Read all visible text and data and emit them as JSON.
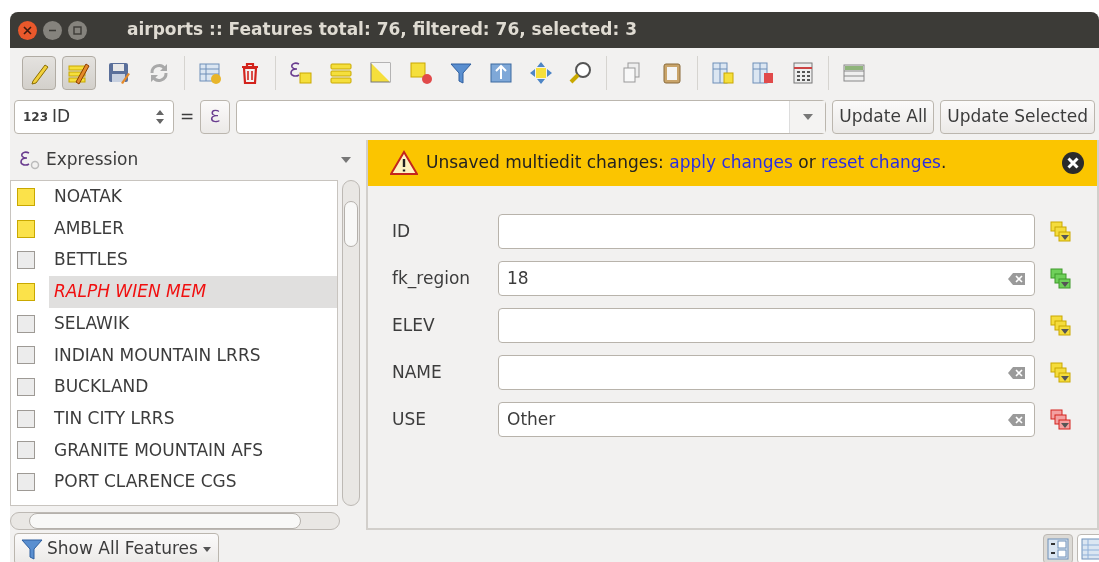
{
  "window": {
    "title": "airports :: Features total: 76, filtered: 76, selected: 3"
  },
  "toolbar": [
    [
      {
        "kind": "pencil",
        "pressed": true
      },
      {
        "kind": "multiedit",
        "pressed": true
      },
      {
        "kind": "save",
        "pressed": false
      },
      {
        "kind": "reload",
        "pressed": false
      }
    ],
    [
      {
        "kind": "addrow",
        "pressed": false
      },
      {
        "kind": "trash",
        "pressed": false
      }
    ],
    [
      {
        "kind": "exprselect",
        "pressed": false
      },
      {
        "kind": "selectall",
        "pressed": false
      },
      {
        "kind": "invert",
        "pressed": false
      },
      {
        "kind": "deselect",
        "pressed": false
      },
      {
        "kind": "funnel",
        "pressed": false
      },
      {
        "kind": "movetop",
        "pressed": false
      },
      {
        "kind": "pan",
        "pressed": false
      },
      {
        "kind": "zoom",
        "pressed": false
      }
    ],
    [
      {
        "kind": "copy",
        "pressed": false
      },
      {
        "kind": "paste",
        "pressed": false
      }
    ],
    [
      {
        "kind": "newcol",
        "pressed": false
      },
      {
        "kind": "delcol",
        "pressed": false
      },
      {
        "kind": "calc",
        "pressed": false
      }
    ],
    [
      {
        "kind": "format",
        "pressed": false
      }
    ]
  ],
  "filter_row": {
    "field_type": "123",
    "field": "ID",
    "operator": "=",
    "expression_button": "ℇ",
    "buttons": [
      "Update All",
      "Update Selected"
    ]
  },
  "list_header": {
    "label": "Expression"
  },
  "features": [
    {
      "name": "NOATAK",
      "selected": true,
      "current": false
    },
    {
      "name": "AMBLER",
      "selected": true,
      "current": false
    },
    {
      "name": "BETTLES",
      "selected": false,
      "current": false
    },
    {
      "name": "RALPH WIEN MEM",
      "selected": true,
      "current": true
    },
    {
      "name": "SELAWIK",
      "selected": false,
      "current": false
    },
    {
      "name": "INDIAN MOUNTAIN LRRS",
      "selected": false,
      "current": false
    },
    {
      "name": "BUCKLAND",
      "selected": false,
      "current": false
    },
    {
      "name": "TIN CITY LRRS",
      "selected": false,
      "current": false
    },
    {
      "name": "GRANITE MOUNTAIN AFS",
      "selected": false,
      "current": false
    },
    {
      "name": "PORT CLARENCE CGS",
      "selected": false,
      "current": false
    }
  ],
  "message": {
    "parts": [
      {
        "kind": "text",
        "text": "Unsaved multiedit changes: "
      },
      {
        "kind": "link",
        "text": "apply changes"
      },
      {
        "kind": "text",
        "text": " or "
      },
      {
        "kind": "link",
        "text": "reset changes"
      },
      {
        "kind": "text",
        "text": "."
      }
    ]
  },
  "fields": [
    {
      "label": "ID",
      "clearable": false,
      "kind": "mixed"
    },
    {
      "label": "fk_region",
      "value": "18",
      "clearable": true,
      "kind": "same"
    },
    {
      "label": "ELEV",
      "clearable": false,
      "kind": "mixed"
    },
    {
      "label": "NAME",
      "clearable": true,
      "kind": "mixed"
    },
    {
      "label": "USE",
      "value": "Other",
      "clearable": true,
      "kind": "changed"
    }
  ],
  "bottom": {
    "filter_button": "Show All Features",
    "views": [
      {
        "kind": "form",
        "selected": true
      },
      {
        "kind": "table",
        "selected": false
      }
    ]
  }
}
